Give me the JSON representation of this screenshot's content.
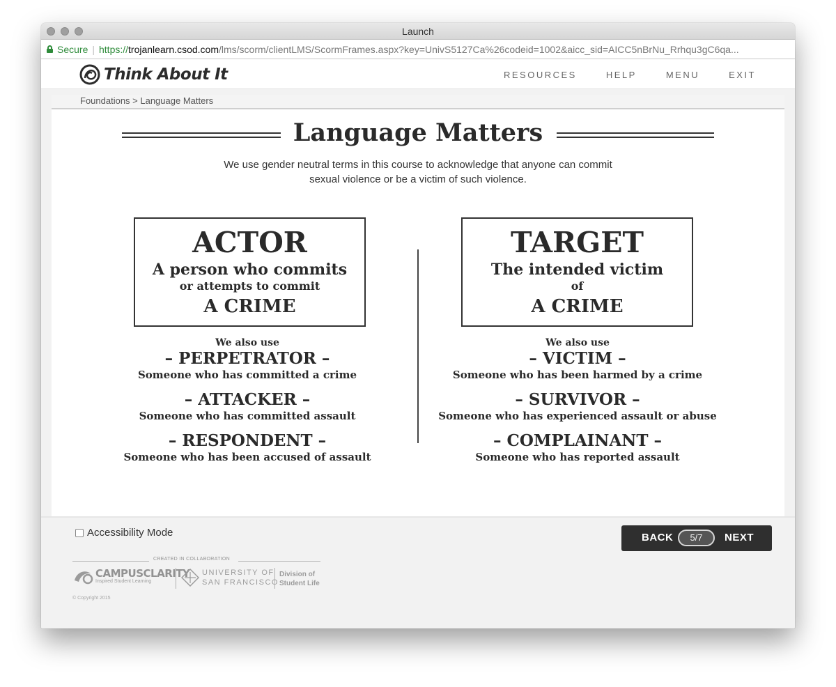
{
  "window": {
    "title": "Launch"
  },
  "urlbar": {
    "secure_label": "Secure",
    "scheme": "https://",
    "host": "trojanlearn.csod.com",
    "path": "/lms/scorm/clientLMS/ScormFrames.aspx?key=UnivS5127Ca%26codeid=1002&aicc_sid=AICC5nBrNu_Rrhqu3gC6qa..."
  },
  "header": {
    "logo_text": "Think About It",
    "nav": [
      "RESOURCES",
      "HELP",
      "MENU",
      "EXIT"
    ]
  },
  "breadcrumb": "Foundations > Language Matters",
  "main": {
    "title": "Language Matters",
    "intro_line1": "We use gender neutral terms in this course to acknowledge that anyone can commit",
    "intro_line2": "sexual violence or be a victim of such violence.",
    "actor": {
      "title": "ACTOR",
      "line1": "A person who commits",
      "line2": "or attempts to commit",
      "line3": "A CRIME",
      "also": "We also use",
      "terms": [
        {
          "name": "– PERPETRATOR –",
          "desc": "Someone who has committed a crime"
        },
        {
          "name": "– ATTACKER –",
          "desc": "Someone who has committed assault"
        },
        {
          "name": "– RESPONDENT –",
          "desc": "Someone who has been accused of assault"
        }
      ]
    },
    "target": {
      "title": "TARGET",
      "line1": "The intended victim",
      "line2": "of",
      "line3": "A CRIME",
      "also": "We also use",
      "terms": [
        {
          "name": "– VICTIM –",
          "desc": "Someone who has been harmed by a crime"
        },
        {
          "name": "– SURVIVOR –",
          "desc": "Someone who has experienced assault or abuse"
        },
        {
          "name": "– COMPLAINANT –",
          "desc": "Someone who has reported assault"
        }
      ]
    }
  },
  "footer": {
    "accessibility_label": "Accessibility Mode",
    "back_label": "BACK",
    "next_label": "NEXT",
    "page_count": "5/7",
    "collab_label": "CREATED IN COLLABORATION",
    "campus_name": "CAMPUSCLARITY",
    "campus_tagline": "Inspired Student Learning",
    "usf_line1": "UNIVERSITY OF",
    "usf_line2": "SAN FRANCISCO",
    "dsl_line1": "Division of",
    "dsl_line2": "Student Life",
    "copyright": "© Copyright 2015"
  }
}
